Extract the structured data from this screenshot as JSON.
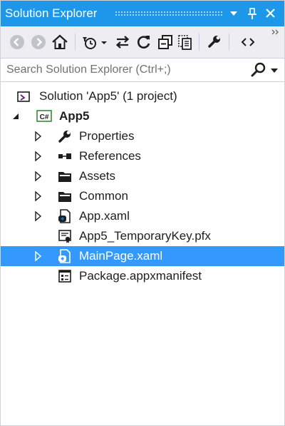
{
  "title": "Solution Explorer",
  "search": {
    "placeholder": "Search Solution Explorer (Ctrl+;)"
  },
  "tree": {
    "solution": "Solution 'App5' (1 project)",
    "project": "App5",
    "project_badge": "C#",
    "items": [
      {
        "label": "Properties",
        "icon": "wrench-icon",
        "expandable": true
      },
      {
        "label": "References",
        "icon": "references-icon",
        "expandable": true
      },
      {
        "label": "Assets",
        "icon": "folder-icon",
        "expandable": true
      },
      {
        "label": "Common",
        "icon": "folder-icon",
        "expandable": true
      },
      {
        "label": "App.xaml",
        "icon": "xaml-file-icon",
        "expandable": true
      },
      {
        "label": "App5_TemporaryKey.pfx",
        "icon": "certificate-icon",
        "expandable": false
      },
      {
        "label": "MainPage.xaml",
        "icon": "xaml-file-icon",
        "expandable": true,
        "selected": true
      },
      {
        "label": "Package.appxmanifest",
        "icon": "manifest-icon",
        "expandable": false
      }
    ]
  },
  "colors": {
    "titlebar": "#1c97ea",
    "selection": "#3399ff",
    "toolbar": "#eeeef2"
  }
}
